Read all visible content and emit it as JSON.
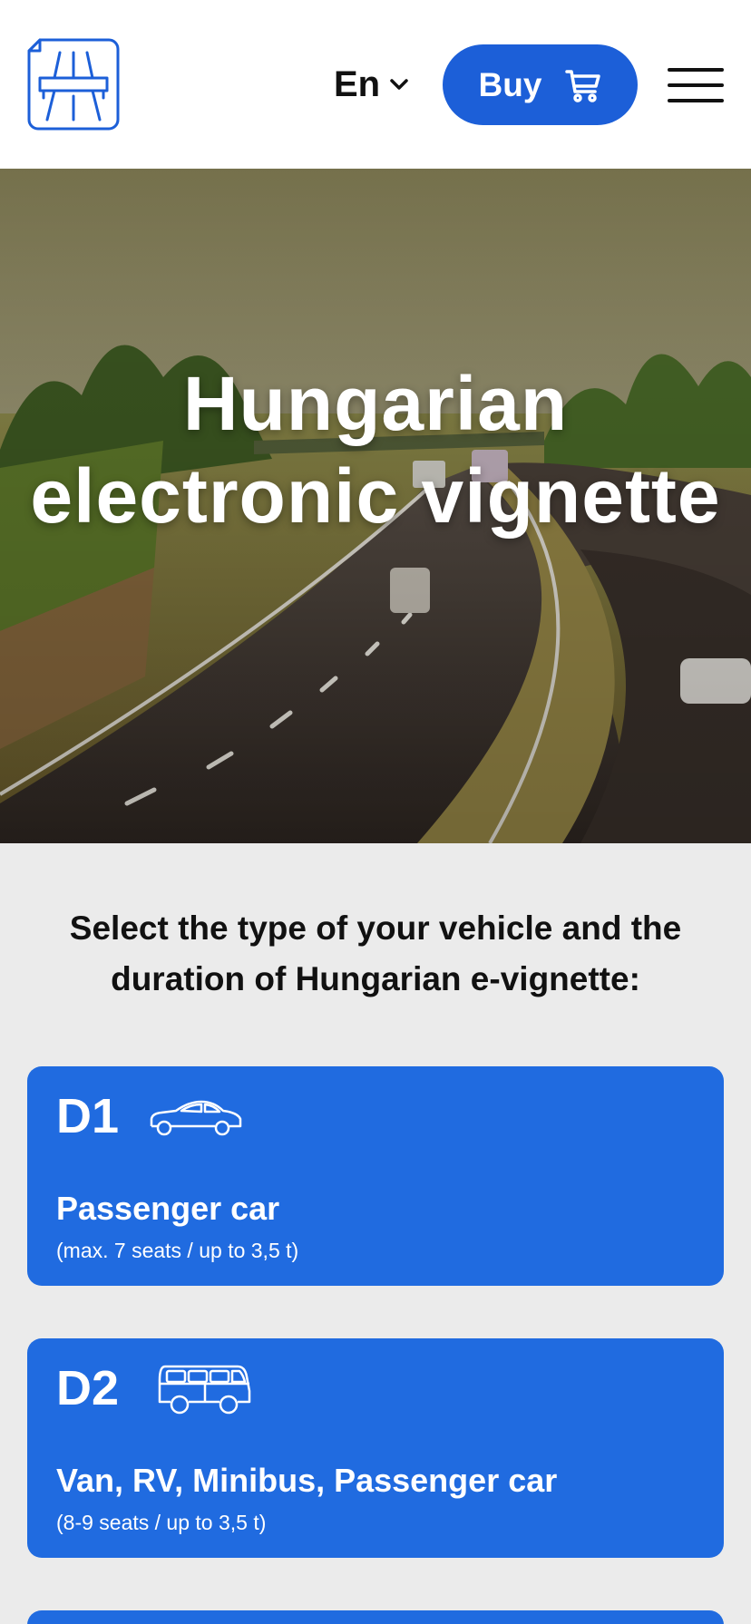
{
  "header": {
    "logo_icon": "highway-road-icon",
    "language": {
      "label": "En",
      "icon": "chevron-down-icon"
    },
    "buy_button": {
      "label": "Buy",
      "icon": "cart-icon"
    },
    "menu_icon": "hamburger-menu-icon"
  },
  "hero": {
    "title": "Hungarian electronic vignette",
    "background": "highway-photo"
  },
  "intro": {
    "text": "Select the type of your vehicle and the duration of Hungarian e-vignette:"
  },
  "vehicle_categories": [
    {
      "code": "D1",
      "icon": "sedan-car-icon",
      "title": "Passenger car",
      "subtitle": "(max. 7 seats / up to 3,5 t)"
    },
    {
      "code": "D2",
      "icon": "van-icon",
      "title": "Van, RV, Minibus, Passenger car",
      "subtitle": "(8-9 seats / up to 3,5 t)"
    }
  ],
  "colors": {
    "brand_blue": "#1c5fd8",
    "card_blue": "#206be0",
    "page_background": "#ebebeb"
  }
}
